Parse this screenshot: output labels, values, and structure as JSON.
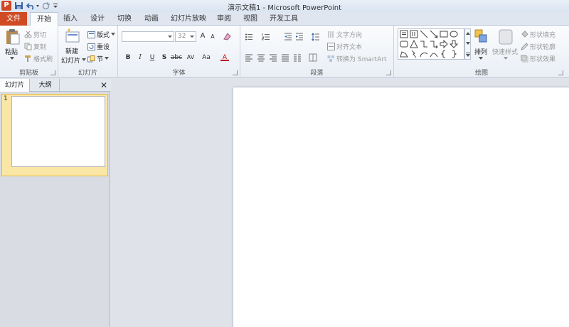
{
  "app": {
    "window_title": "演示文稿1 - Microsoft PowerPoint",
    "logo_letter": "P"
  },
  "tabs": [
    {
      "label": "文件",
      "id": "file"
    },
    {
      "label": "开始",
      "id": "home",
      "active": true
    },
    {
      "label": "插入",
      "id": "insert"
    },
    {
      "label": "设计",
      "id": "design"
    },
    {
      "label": "切换",
      "id": "transitions"
    },
    {
      "label": "动画",
      "id": "animations"
    },
    {
      "label": "幻灯片放映",
      "id": "slideshow"
    },
    {
      "label": "审阅",
      "id": "review"
    },
    {
      "label": "视图",
      "id": "view"
    },
    {
      "label": "开发工具",
      "id": "developer"
    }
  ],
  "ribbon": {
    "clipboard": {
      "label": "剪贴板",
      "paste": "粘贴",
      "cut": "剪切",
      "copy": "复制",
      "format_painter": "格式刷"
    },
    "slides": {
      "label": "幻灯片",
      "new_slide_line1": "新建",
      "new_slide_line2": "幻灯片",
      "layout": "版式",
      "reset": "重设",
      "section": "节"
    },
    "font": {
      "label": "字体",
      "font_name": "",
      "font_size": "32",
      "bold": "B",
      "italic": "I",
      "underline": "U",
      "strike": "S",
      "shadow": "abc",
      "spacing": "AV",
      "case": "Aa",
      "color": "A",
      "grow": "A",
      "shrink": "A"
    },
    "paragraph": {
      "label": "段落",
      "text_direction": "文字方向",
      "align_text": "对齐文本",
      "smartart": "转换为 SmartArt"
    },
    "drawing": {
      "label": "绘图",
      "arrange": "排列",
      "quick_styles": "快速样式",
      "shape_fill": "形状填充",
      "shape_outline": "形状轮廓",
      "shape_effects": "形状效果"
    }
  },
  "panel": {
    "tab_slides": "幻灯片",
    "tab_outline": "大纲",
    "close": "✕",
    "slide_number": "1"
  }
}
